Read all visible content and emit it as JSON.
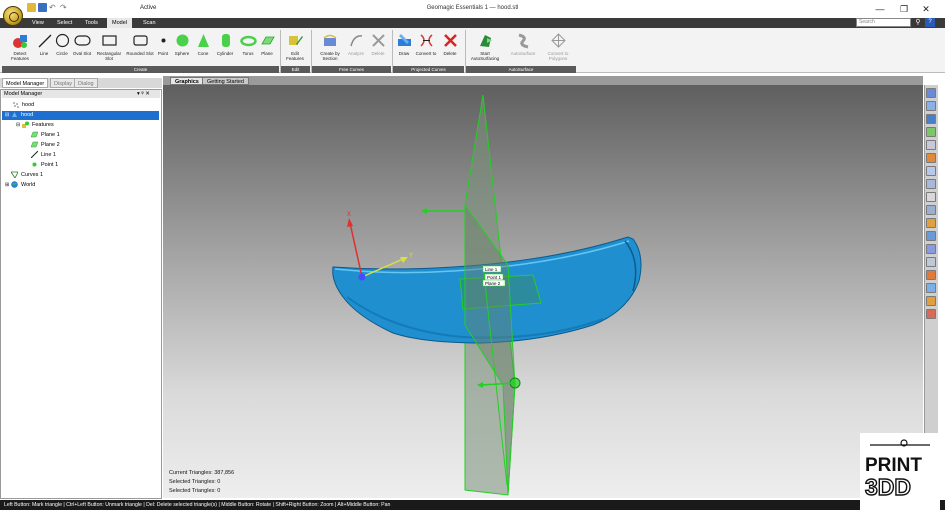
{
  "window": {
    "title": "Geomagic Essentials 1 — hood.stl",
    "active_label": "Active",
    "minimize": "—",
    "maximize": "❐",
    "close": "✕"
  },
  "tabs": [
    {
      "label": "View"
    },
    {
      "label": "Select"
    },
    {
      "label": "Tools"
    },
    {
      "label": "Model"
    },
    {
      "label": "Scan"
    }
  ],
  "search": {
    "placeholder": "Search",
    "help": "?"
  },
  "ribbon": {
    "buttons": [
      {
        "label": "Detect Features"
      },
      {
        "label": "Line"
      },
      {
        "label": "Circle"
      },
      {
        "label": "Oval Slot"
      },
      {
        "label": "Rectangular Slot"
      },
      {
        "label": "Rounded Slot"
      },
      {
        "label": "Point"
      },
      {
        "label": "Sphere"
      },
      {
        "label": "Cone"
      },
      {
        "label": "Cylinder"
      },
      {
        "label": "Torus"
      },
      {
        "label": "Plane"
      },
      {
        "label": "Edit Features"
      },
      {
        "label": "Create by Section"
      },
      {
        "label": "Analyze"
      },
      {
        "label": "Delete"
      },
      {
        "label": "Draw"
      },
      {
        "label": "Convert to"
      },
      {
        "label": "Delete"
      },
      {
        "label": "Start AutoSurfacing"
      },
      {
        "label": "AutoSurface"
      },
      {
        "label": "Convert to Polygons"
      }
    ],
    "groups": [
      {
        "label": "Create"
      },
      {
        "label": "Edit"
      },
      {
        "label": "Free Curves"
      },
      {
        "label": "Projected Curves"
      },
      {
        "label": "AutoSurface"
      }
    ]
  },
  "left_panel": {
    "tabs": [
      {
        "label": "Model Manager"
      },
      {
        "label": "Display"
      },
      {
        "label": "Dialog"
      }
    ],
    "title": "Model Manager",
    "controls": "▾ ᵠ ✕",
    "tree": [
      {
        "label": "hood"
      },
      {
        "label": "hood"
      },
      {
        "label": "Features"
      },
      {
        "label": "Plane 1"
      },
      {
        "label": "Plane 2"
      },
      {
        "label": "Line 1"
      },
      {
        "label": "Point 1"
      },
      {
        "label": "Curves 1"
      },
      {
        "label": "World"
      }
    ]
  },
  "viewport": {
    "tabs": [
      {
        "label": "Graphics"
      },
      {
        "label": "Getting Started"
      }
    ],
    "labels": {
      "line": "Line 1",
      "point": "Point 1",
      "plane": "Plane 2",
      "axis_x": "X",
      "axis_y": "Y"
    },
    "stats": [
      {
        "text": "Current Triangles: 387,856"
      },
      {
        "text": "Selected Triangles: 0"
      },
      {
        "text": "Selected Triangles: 0"
      }
    ]
  },
  "statusbar": {
    "text": "Left Button: Mark triangle | Ctrl+Left Button: Unmark triangle | Del: Delete selected triangle(s) | Middle Button: Rotate | Shift+Right Button: Zoom | Alt+Middle Button: Pan"
  },
  "watermark": {
    "line1": "PRINT",
    "line2": "3DD"
  },
  "colors": {
    "mesh": "#1f8fd0",
    "plane_edge": "#22d022",
    "selection": "#1e6fd0"
  }
}
